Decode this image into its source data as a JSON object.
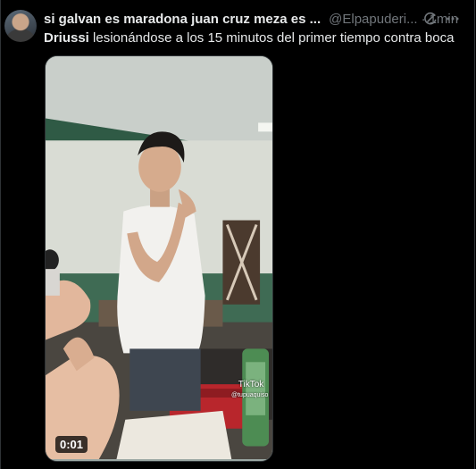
{
  "tweet": {
    "display_name": "si galvan es maradona juan cruz meza es ...",
    "handle": "@Elpapuderi...",
    "separator": "·",
    "time": "1min",
    "mention": "Driussi",
    "text": " lesionándose a los 15 minutos del primer tiempo contra boca"
  },
  "media": {
    "duration": "0:01",
    "watermark": "TikTok",
    "watermark_user": "@tupuaquiso"
  },
  "icons": {
    "avatar": "user-avatar",
    "grok": "grok-icon",
    "more": "more-icon"
  }
}
